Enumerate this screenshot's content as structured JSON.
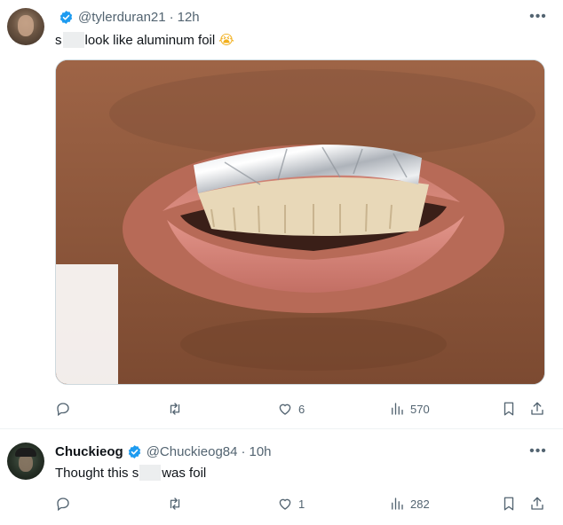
{
  "tweets": [
    {
      "display_name": "",
      "handle": "@tylerduran21",
      "separator": "·",
      "time": "12h",
      "text_before": "s",
      "text_after": "look like aluminum foil",
      "emoji": "😭",
      "has_media": true,
      "actions": {
        "reply": "",
        "retweet": "",
        "like": "6",
        "views": "570"
      }
    },
    {
      "display_name": "Chuckieog",
      "handle": "@Chuckieog84",
      "separator": "·",
      "time": "10h",
      "text_before": "Thought this s",
      "text_after": "was foil",
      "actions": {
        "reply": "",
        "retweet": "",
        "like": "1",
        "views": "282"
      }
    }
  ],
  "more_glyph": "•••",
  "icons": [
    "verified-badge-icon",
    "more-options-icon",
    "reply-icon",
    "retweet-icon",
    "like-icon",
    "views-icon",
    "bookmark-icon",
    "share-icon"
  ],
  "colors": {
    "verified": "#1d9bf0",
    "muted": "#536471",
    "text": "#0f1419"
  }
}
